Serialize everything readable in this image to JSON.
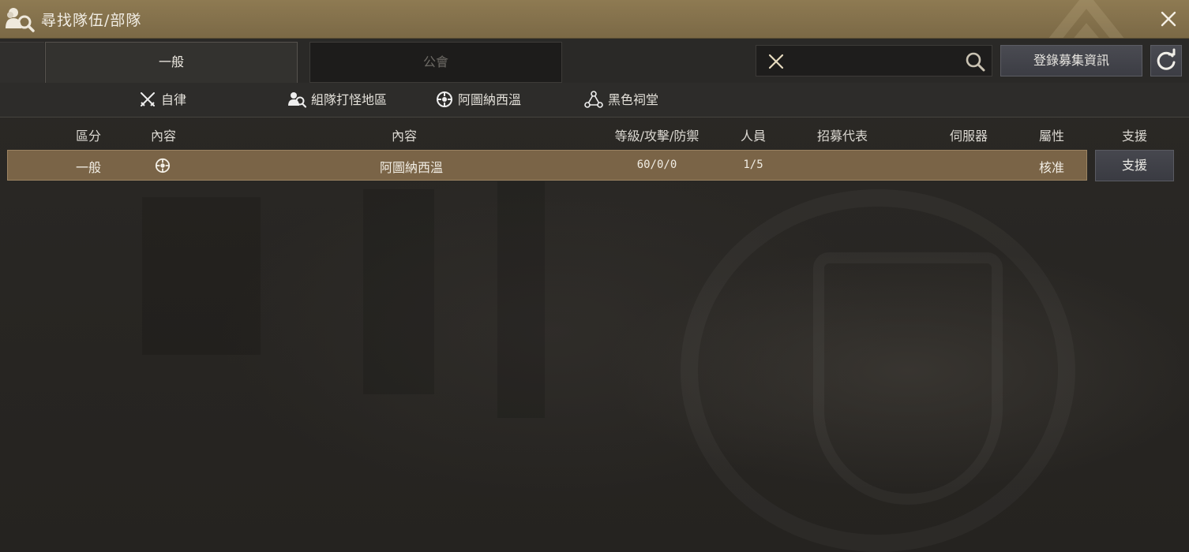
{
  "window": {
    "title": "尋找隊伍/部隊",
    "title_icon": "party-search-icon",
    "close_icon": "close-icon"
  },
  "tabs": [
    {
      "label": "一般",
      "active": true
    },
    {
      "label": "公會",
      "active": false
    }
  ],
  "search": {
    "value": "",
    "placeholder": "",
    "clear_icon": "close-icon",
    "search_icon": "search-icon"
  },
  "toolbar": {
    "register_label": "登錄募集資訊",
    "refresh_icon": "refresh-icon"
  },
  "categories": [
    {
      "label": "自律",
      "icon": "crossed-swords-icon"
    },
    {
      "label": "組隊打怪地區",
      "icon": "party-icon"
    },
    {
      "label": "阿圖納西溫",
      "icon": "compass-wheel-icon"
    },
    {
      "label": "黑色祠堂",
      "icon": "triangle-nodes-icon"
    }
  ],
  "table": {
    "headers": [
      "區分",
      "內容",
      "內容",
      "等級/攻擊/防禦",
      "人員",
      "招募代表",
      "伺服器",
      "屬性",
      "支援"
    ],
    "rows": [
      {
        "division": "一般",
        "content_icon": "compass-wheel-icon",
        "content": "阿圖納西溫",
        "stats": "60/0/0",
        "members": "1/5",
        "leader": "",
        "server": "",
        "attribute": "核准",
        "support_label": "支援"
      }
    ]
  },
  "colors": {
    "titlebar": "#8e7a52",
    "row_highlight": "#7a6447",
    "background": "#242220",
    "button": "#45464d"
  }
}
